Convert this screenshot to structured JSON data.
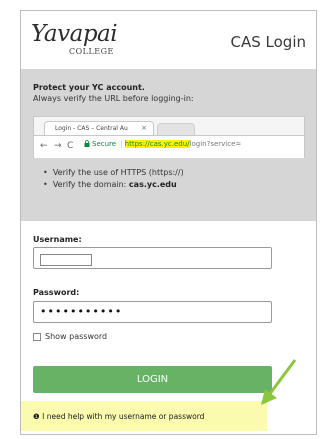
{
  "header": {
    "logo_text": "Yavapai",
    "logo_subtext": "COLLEGE",
    "title": "CAS Login"
  },
  "info": {
    "title": "Protect your YC account.",
    "subtitle": "Always verify the URL before logging-in:",
    "browser": {
      "tab_title": "Login - CAS – Central Au",
      "tab_close": "×",
      "nav_back": "←",
      "nav_forward": "→",
      "nav_reload": "C",
      "secure_label": "Secure",
      "url_highlight": "https://cas.yc.edu/",
      "url_rest": "login?service="
    },
    "bullets": [
      {
        "text": "Verify the use of HTTPS (https://)"
      },
      {
        "prefix": "Verify the domain: ",
        "strong": "cas.yc.edu"
      }
    ]
  },
  "form": {
    "username_label": "Username:",
    "password_label": "Password:",
    "password_value": "•••••••••••",
    "show_password_label": "Show password",
    "login_label": "LOGIN",
    "help_icon": "❶",
    "help_text": "I need help with my username or password"
  },
  "colors": {
    "info_bg": "#d6d6d6",
    "login_button": "#66b366",
    "highlight": "#fff200",
    "help_bg": "#fbfbb0",
    "arrow": "#8cc63f"
  }
}
